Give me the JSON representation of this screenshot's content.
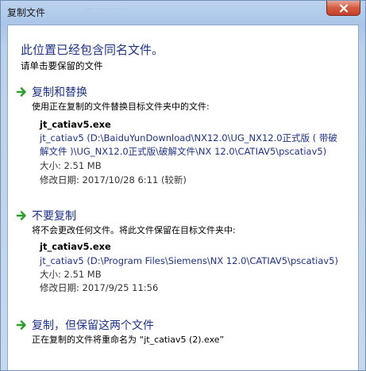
{
  "window": {
    "title": "复制文件",
    "ghost_text": "… …… ……"
  },
  "header": {
    "heading": "此位置已经包含同名文件。",
    "subheading": "请单击要保留的文件"
  },
  "options": [
    {
      "title": "复制和替换",
      "description": "使用正在复制的文件替换目标文件夹中的文件:",
      "file_name": "jt_catiav5.exe",
      "file_path_line1": "jt_catiav5 (D:\\BaiduYunDownload\\NX12.0\\UG_NX12.0正式版 ( 带破",
      "file_path_line2": "解文件 )\\UG_NX12.0正式版\\破解文件\\NX 12.0\\CATIAV5\\pscatiav5)",
      "size": "大小: 2.51 MB",
      "modified": "修改日期: 2017/10/28 6:11 (较新)"
    },
    {
      "title": "不要复制",
      "description": "将不会更改任何文件。将此文件保留在目标文件夹中:",
      "file_name": "jt_catiav5.exe",
      "file_path_line1": "jt_catiav5 (D:\\Program Files\\Siemens\\NX 12.0\\CATIAV5\\pscatiav5)",
      "size": "大小: 2.51 MB",
      "modified": "修改日期: 2017/9/25 11:56"
    },
    {
      "title": "复制，但保留这两个文件",
      "description": "正在复制的文件将重命名为 “jt_catiav5 (2).exe”"
    }
  ],
  "colors": {
    "link_blue": "#1e3287",
    "arrow_green": "#2e9e2e",
    "close_red": "#c4402a"
  },
  "icons": {
    "close": "close-icon",
    "arrow": "green-arrow-icon"
  }
}
